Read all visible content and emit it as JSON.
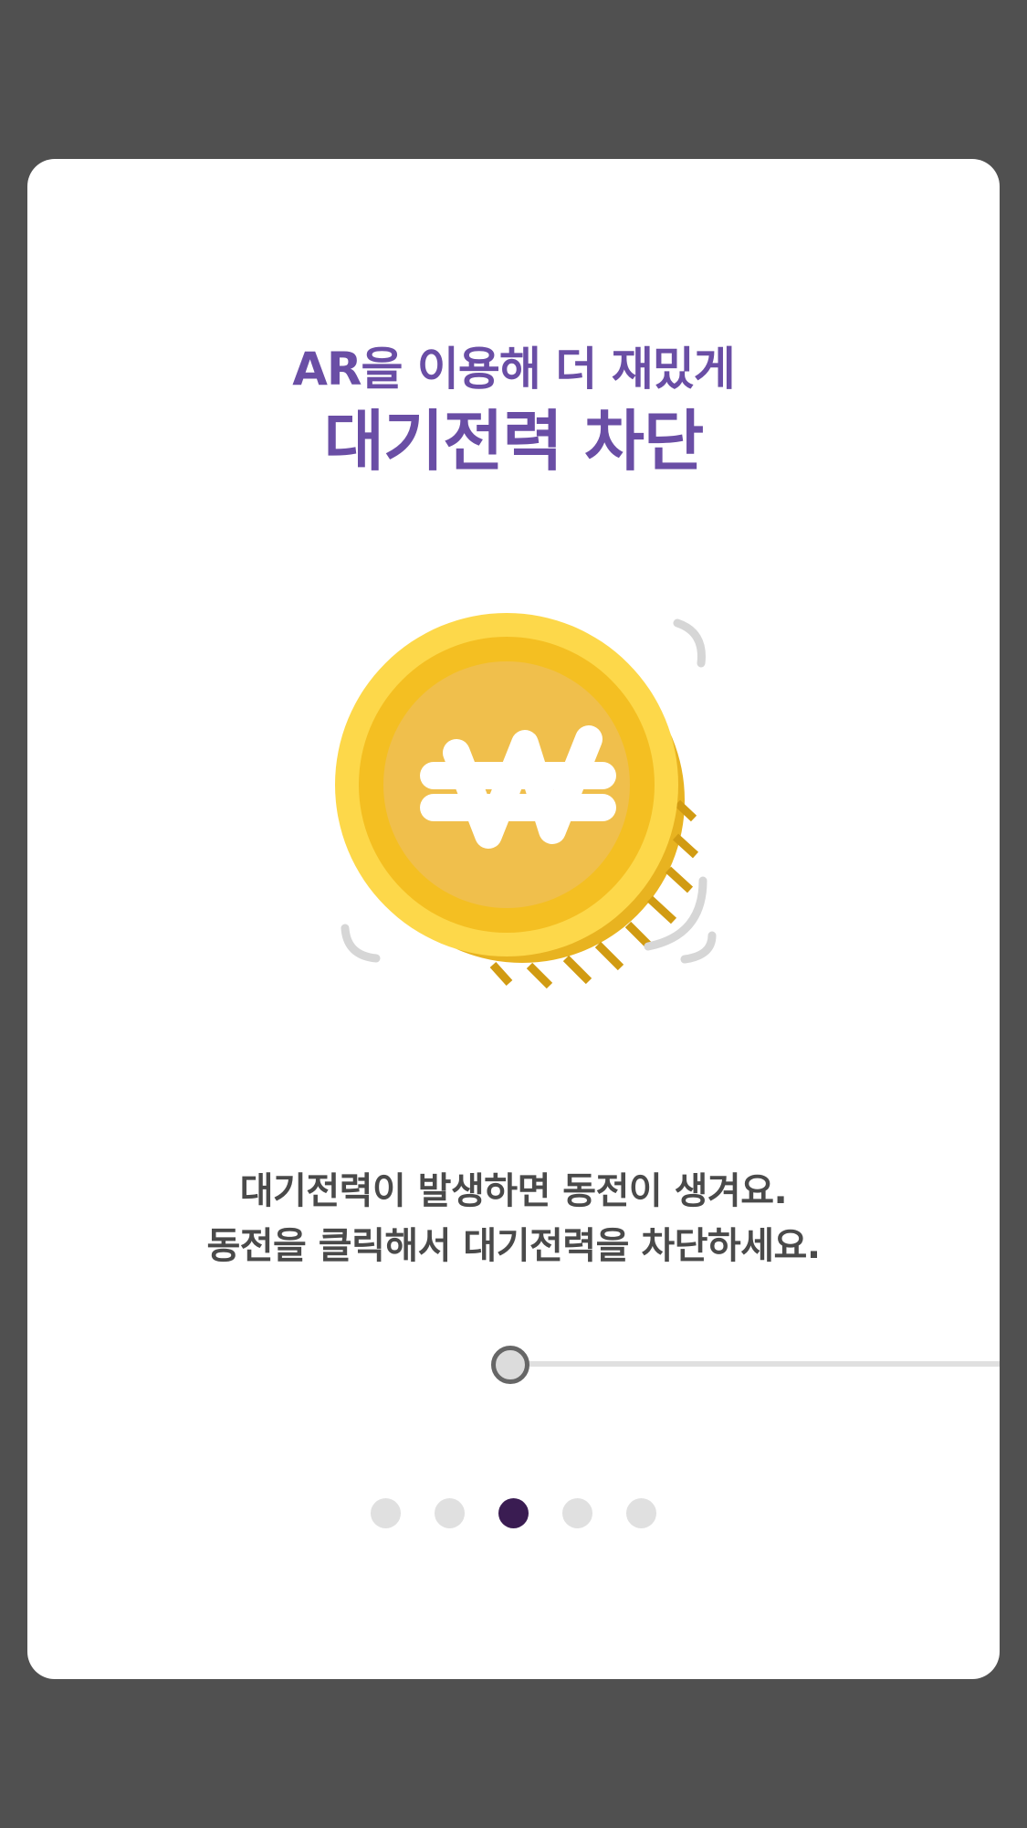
{
  "onboarding": {
    "subtitle": "AR을 이용해 더 재밌게",
    "title": "대기전력 차단",
    "illustration_icon": "won-coin-icon",
    "description_line1": "대기전력이 발생하면 동전이 생겨요.",
    "description_line2": "동전을 클릭해서 대기전력을 차단하세요.",
    "progress": 0,
    "pagination": {
      "total_pages": 5,
      "current_page": 3
    }
  },
  "colors": {
    "background": "#505050",
    "card": "#ffffff",
    "accent_purple": "#6a4ea5",
    "active_dot": "#3a1c52",
    "inactive_dot": "#e0e0e0",
    "coin_gold": "#f5c024"
  }
}
